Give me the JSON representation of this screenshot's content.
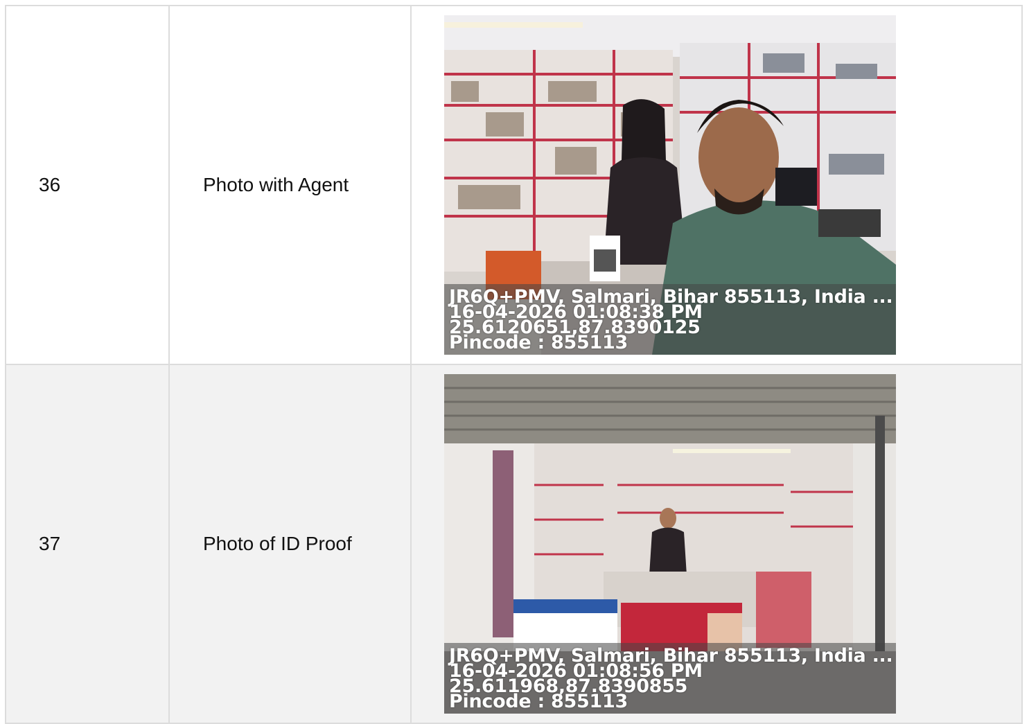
{
  "rows": [
    {
      "number": "36",
      "label": "Photo with Agent",
      "photo": {
        "subject": "selfie-inside-shop",
        "overlay": {
          "address": "JR6Q+PMV, Salmari, Bihar 855113, India ...",
          "datetime": "16-04-2026 01:08:38 PM",
          "coords": "25.6120651,87.8390125",
          "pincode": "Pincode : 855113"
        }
      }
    },
    {
      "number": "37",
      "label": "Photo of ID Proof",
      "photo": {
        "subject": "shop-front",
        "overlay": {
          "address": "JR6Q+PMV, Salmari, Bihar 855113, India ...",
          "datetime": "16-04-2026 01:08:56 PM",
          "coords": "25.611968,87.8390855",
          "pincode": "Pincode : 855113"
        }
      }
    }
  ],
  "colors": {
    "border": "#dcdcdc",
    "alt_row": "#f2f2f2",
    "overlay_text": "#ffffff"
  }
}
